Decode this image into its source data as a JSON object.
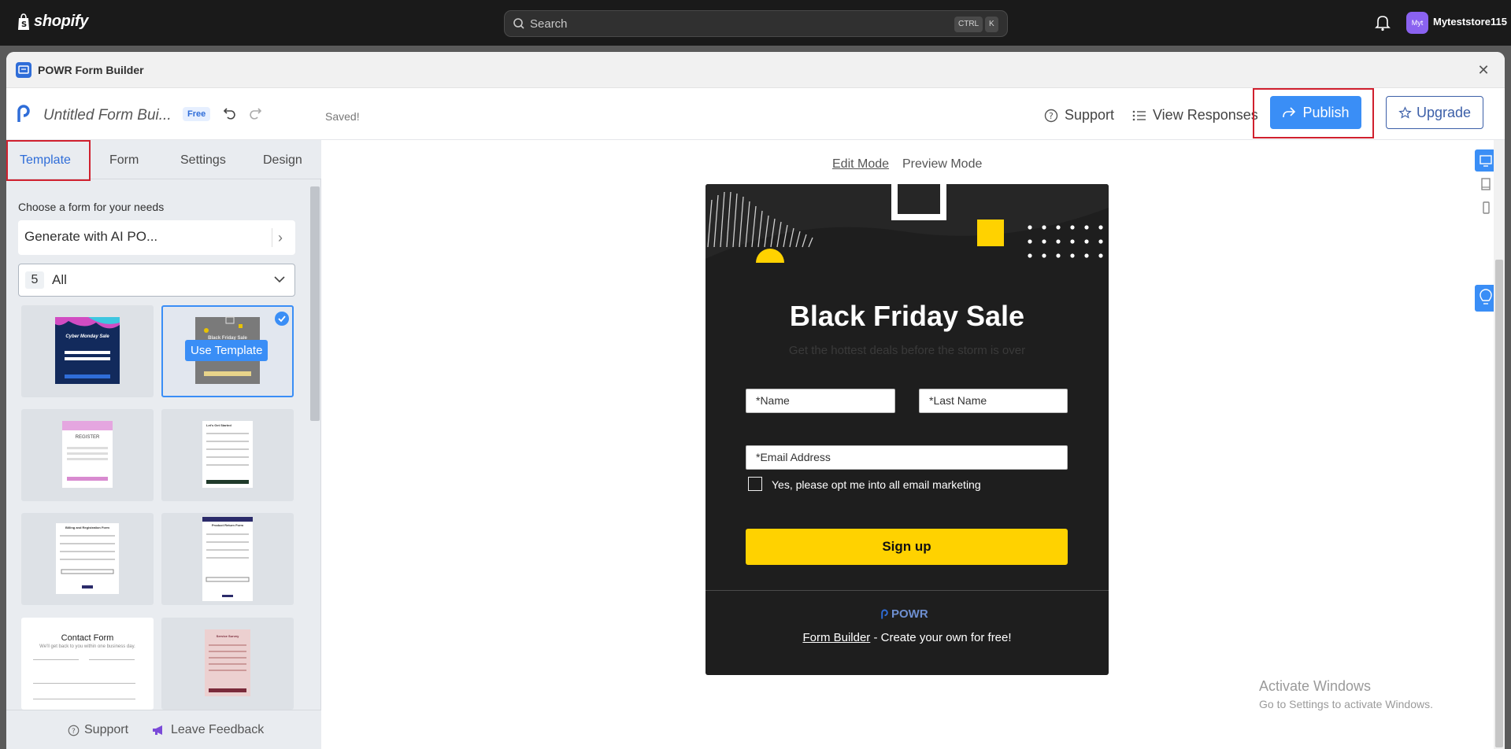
{
  "shopify": {
    "logo_text": "shopify",
    "search_placeholder": "Search",
    "kbd_ctrl": "CTRL",
    "kbd_k": "K",
    "store_initials": "Myt",
    "store_name": "Myteststore115"
  },
  "app": {
    "title": "POWR Form Builder",
    "close_glyph": "✕"
  },
  "header": {
    "form_title": "Untitled Form Bui...",
    "badge": "Free",
    "saved": "Saved!",
    "support": "Support",
    "view_responses": "View Responses",
    "publish": "Publish",
    "upgrade": "Upgrade"
  },
  "tabs": [
    {
      "label": "Template",
      "active": true
    },
    {
      "label": "Form"
    },
    {
      "label": "Settings"
    },
    {
      "label": "Design"
    }
  ],
  "left": {
    "heading": "Choose a form for your needs",
    "generate_ai": "Generate with AI PO...",
    "filter_count": "5",
    "filter_value": "All",
    "use_template": "Use Template",
    "thumbnails": [
      {
        "label": "Cyber Monday Sale"
      },
      {
        "label": "Black Friday Sale",
        "selected": true
      },
      {
        "label": "REGISTER"
      },
      {
        "label": "Let's Get Started"
      },
      {
        "label": "Billing and Registration Form"
      },
      {
        "label": "Product Return Form"
      },
      {
        "label": "Contact Form",
        "sub": "We'll get back to you within one business day."
      },
      {
        "label": "Service Survey"
      }
    ],
    "footer_support": "Support",
    "footer_feedback": "Leave Feedback"
  },
  "preview": {
    "edit_mode": "Edit Mode",
    "preview_mode": "Preview Mode"
  },
  "form_card": {
    "title": "Black Friday Sale",
    "subtitle": "Get the hottest deals before the storm is over",
    "name_placeholder": "*Name",
    "last_name_placeholder": "*Last Name",
    "email_placeholder": "*Email Address",
    "opt_in_label": "Yes, please opt me into all email marketing",
    "submit": "Sign up",
    "brand": "POWR",
    "footer_link": "Form Builder",
    "footer_text": " - Create your own for free!"
  },
  "windows": {
    "line1": "Activate Windows",
    "line2": "Go to Settings to activate Windows."
  },
  "colors": {
    "primary": "#3a8ef6",
    "highlight": "#d0202e",
    "form_bg": "#1e1e1e",
    "accent_yellow": "#ffd200"
  }
}
